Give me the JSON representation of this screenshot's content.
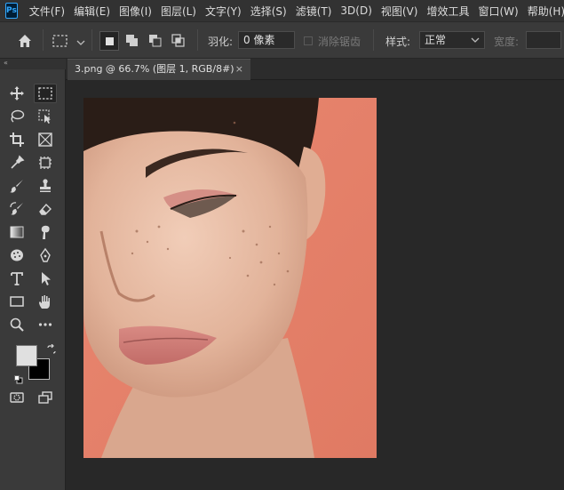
{
  "app": {
    "logo_text": "Ps"
  },
  "menu": [
    "文件(F)",
    "编辑(E)",
    "图像(I)",
    "图层(L)",
    "文字(Y)",
    "选择(S)",
    "滤镜(T)",
    "3D(D)",
    "视图(V)",
    "增效工具",
    "窗口(W)",
    "帮助(H)"
  ],
  "options": {
    "feather_label": "羽化:",
    "feather_value": "0 像素",
    "antialias_label": "消除锯齿",
    "style_label": "样式:",
    "style_value": "正常",
    "width_label": "宽度:"
  },
  "tools_header": "«",
  "document": {
    "tab_title": "3.png @ 66.7% (图层 1, RGB/8#)",
    "close_glyph": "×"
  },
  "colors": {
    "foreground": "#e0e0e0",
    "background": "#000000",
    "photo_bg": "#e8826c",
    "accent": "#31a8ff"
  }
}
